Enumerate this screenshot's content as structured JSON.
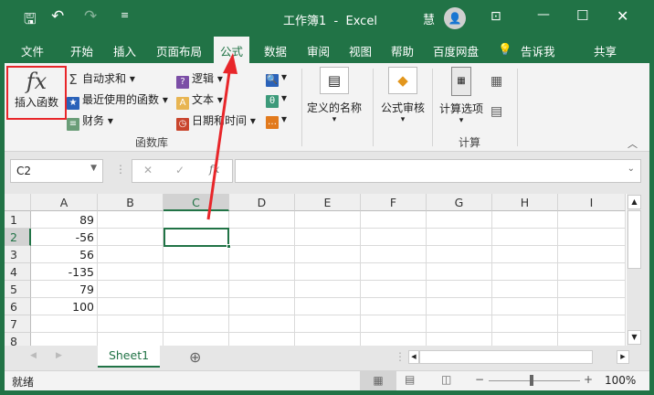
{
  "title_bar": {
    "title": "工作簿1  -  Excel",
    "user": "慧",
    "undo": "↶",
    "redo": "↷"
  },
  "tabs": [
    "文件",
    "开始",
    "插入",
    "页面布局",
    "公式",
    "数据",
    "审阅",
    "视图",
    "帮助",
    "百度网盘",
    "告诉我",
    "共享"
  ],
  "ribbon": {
    "insert_function": "插入函数",
    "autosum": "自动求和",
    "recent": "最近使用的函数",
    "finance": "财务",
    "logic": "逻辑",
    "text": "文本",
    "datetime": "日期和时间",
    "group_library": "函数库",
    "defined_names": "定义的名称",
    "formula_audit": "公式审核",
    "calc_options": "计算选项",
    "group_calc": "计算"
  },
  "formula_bar": {
    "name_box": "C2",
    "formula": ""
  },
  "columns": [
    "A",
    "B",
    "C",
    "D",
    "E",
    "F",
    "G",
    "H",
    "I"
  ],
  "rows": [
    "1",
    "2",
    "3",
    "4",
    "5",
    "6",
    "7",
    "8"
  ],
  "cells_A": [
    "89",
    "-56",
    "56",
    "-135",
    "79",
    "100",
    "",
    ""
  ],
  "selected_cell": "C2",
  "sheets": [
    "Sheet1"
  ],
  "status": {
    "text": "就绪",
    "zoom": "100%"
  },
  "colors": {
    "accent": "#217346",
    "highlight": "#e8262a"
  }
}
